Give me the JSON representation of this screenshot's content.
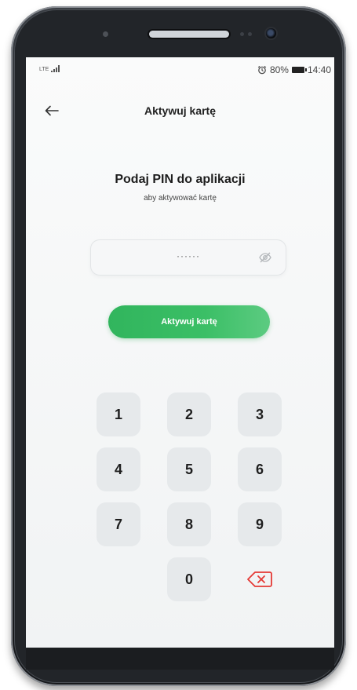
{
  "status_bar": {
    "network": "LTE",
    "battery": "80%",
    "time": "14:40"
  },
  "header": {
    "title": "Aktywuj kartę",
    "back_icon": "arrow-left-icon"
  },
  "pin_prompt": {
    "title": "Podaj PIN do aplikacji",
    "subtitle": "aby aktywować kartę"
  },
  "pin_field": {
    "value": "······",
    "visibility_icon": "eye-off-icon"
  },
  "activate_button": {
    "label": "Aktywuj kartę",
    "color": "#3bbf66"
  },
  "keypad": {
    "keys": [
      "1",
      "2",
      "3",
      "4",
      "5",
      "6",
      "7",
      "8",
      "9",
      "0"
    ],
    "delete_icon": "backspace-icon",
    "delete_color": "#e53935"
  }
}
